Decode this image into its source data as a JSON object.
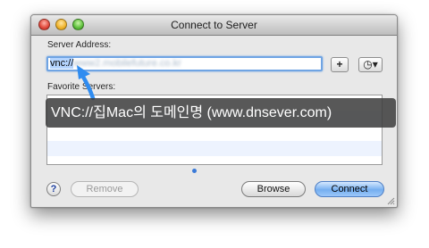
{
  "window": {
    "title": "Connect to Server"
  },
  "server_address": {
    "label": "Server Address:",
    "value_prefix": "vnc://",
    "value_blurred": "www2.mobilefuture.co.kr"
  },
  "buttons": {
    "add": "+",
    "history": "◷▾",
    "help": "?",
    "remove": "Remove",
    "browse": "Browse",
    "connect": "Connect"
  },
  "favorites": {
    "label": "Favorite Servers:",
    "rows": [
      "",
      "",
      "",
      ""
    ]
  },
  "overlay": {
    "text": "VNC://집Mac의 도메인명 (www.dnsever.com)"
  },
  "colors": {
    "accent": "#6fa4e3",
    "arrow": "#2f8cf0",
    "overlay_bg": "#3c3c3c"
  }
}
